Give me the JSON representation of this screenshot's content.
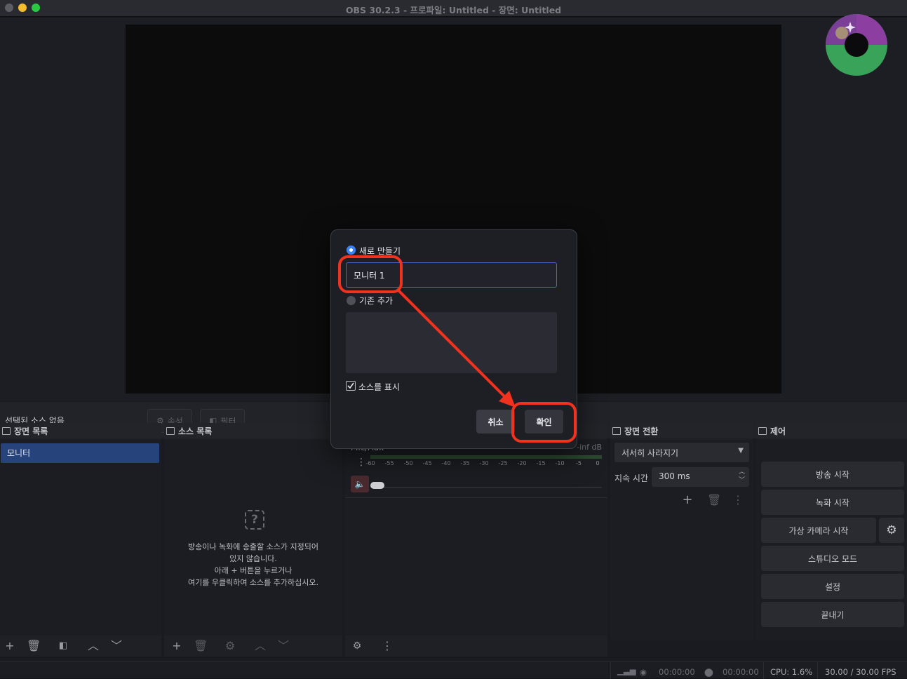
{
  "window": {
    "title": "OBS 30.2.3 - 프로파일: Untitled - 장면: Untitled"
  },
  "source_bar": {
    "no_selection": "선택된 소스 없음",
    "properties_label": "속성",
    "filters_label": "필터"
  },
  "scenes": {
    "title": "장면 목록",
    "items": [
      "모니터"
    ]
  },
  "sources": {
    "title": "소스 목록",
    "empty_lines": [
      "방송이나 녹화에 송출할 소스가 지정되어",
      "있지 않습니다.",
      "아래 + 버튼을 누르거나",
      "여기를 우클릭하여 소스를 추가하십시오."
    ]
  },
  "mixer": {
    "source_name": "Mic/Aux",
    "level": "-inf dB",
    "ticks": [
      "-60",
      "-55",
      "-50",
      "-45",
      "-40",
      "-35",
      "-30",
      "-25",
      "-20",
      "-15",
      "-10",
      "-5",
      "0"
    ]
  },
  "transitions": {
    "title": "장면 전환",
    "selected": "서서히 사라지기",
    "duration_label": "지속 시간",
    "duration_value": "300 ms"
  },
  "controls": {
    "title": "제어",
    "start_streaming": "방송 시작",
    "start_recording": "녹화 시작",
    "start_virtual_camera": "가상 카메라 시작",
    "studio_mode": "스튜디오 모드",
    "settings": "설정",
    "exit": "끝내기"
  },
  "status": {
    "stream_time": "00:00:00",
    "record_time": "00:00:00",
    "cpu": "CPU: 1.6%",
    "fps": "30.00 / 30.00 FPS"
  },
  "dialog": {
    "create_new_label": "새로 만들기",
    "name_value": "모니터 1",
    "add_existing_label": "기존 추가",
    "make_visible_label": "소스를 표시",
    "cancel_label": "취소",
    "ok_label": "확인"
  },
  "colors": {
    "accent": "#3b82f6",
    "annotation": "#f0321e",
    "selection": "#26447b"
  }
}
